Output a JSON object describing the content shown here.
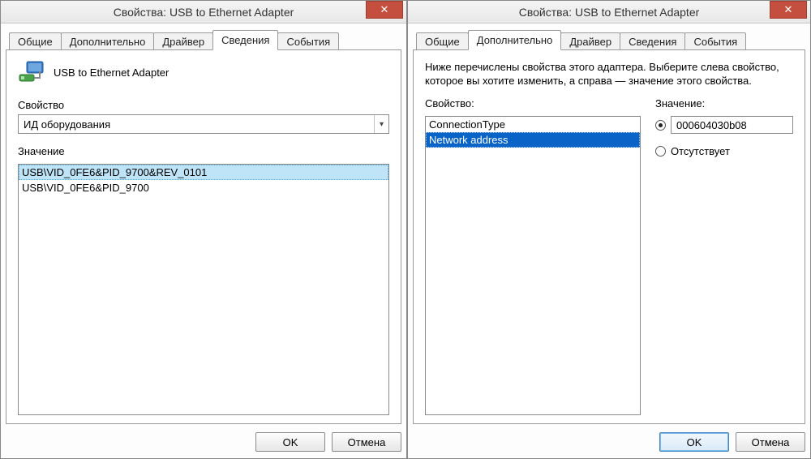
{
  "left": {
    "title": "Свойства: USB to Ethernet Adapter",
    "close_glyph": "✕",
    "tabs": [
      "Общие",
      "Дополнительно",
      "Драйвер",
      "Сведения",
      "События"
    ],
    "active_tab_index": 3,
    "device_name": "USB to Ethernet Adapter",
    "property_label": "Свойство",
    "property_selected": "ИД оборудования",
    "value_label": "Значение",
    "values": [
      "USB\\VID_0FE6&PID_9700&REV_0101",
      "USB\\VID_0FE6&PID_9700"
    ],
    "selected_value_index": 0,
    "ok_label": "OK",
    "cancel_label": "Отмена"
  },
  "right": {
    "title": "Свойства: USB to Ethernet Adapter",
    "close_glyph": "✕",
    "tabs": [
      "Общие",
      "Дополнительно",
      "Драйвер",
      "Сведения",
      "События"
    ],
    "active_tab_index": 1,
    "description": "Ниже перечислены свойства этого адаптера. Выберите слева свойство, которое вы хотите изменить, а справа — значение этого свойства.",
    "property_label": "Свойство:",
    "properties": [
      "ConnectionType",
      "Network address"
    ],
    "selected_property_index": 1,
    "value_label": "Значение:",
    "value_text": "000604030b08",
    "value_radio_checked": true,
    "absent_label": "Отсутствует",
    "absent_radio_checked": false,
    "ok_label": "OK",
    "cancel_label": "Отмена"
  }
}
